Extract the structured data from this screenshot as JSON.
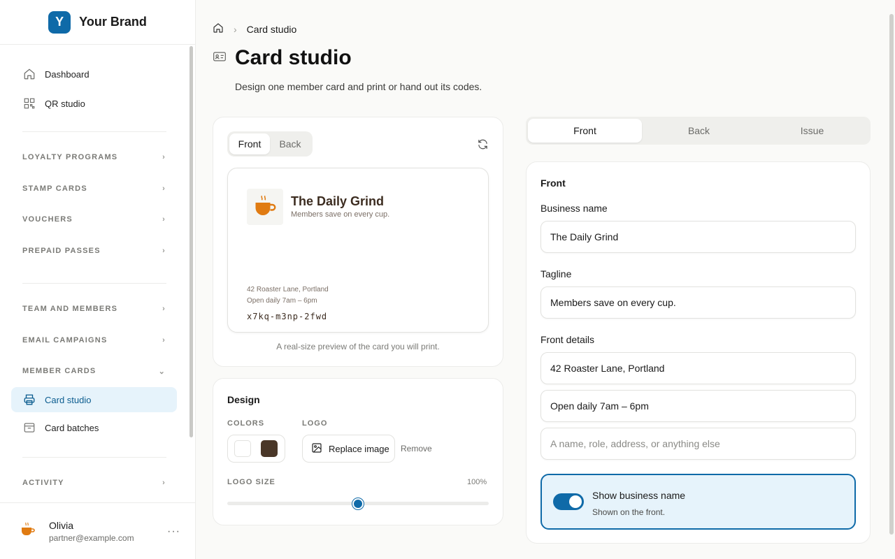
{
  "brand": {
    "letter": "Y",
    "name": "Your Brand"
  },
  "nav": {
    "dashboard": "Dashboard",
    "qr_studio": "QR studio",
    "sections": [
      "LOYALTY PROGRAMS",
      "STAMP CARDS",
      "VOUCHERS",
      "PREPAID PASSES",
      "TEAM AND MEMBERS",
      "EMAIL CAMPAIGNS",
      "MEMBER CARDS",
      "ACTIVITY"
    ],
    "card_studio": "Card studio",
    "card_batches": "Card batches"
  },
  "user": {
    "name": "Olivia",
    "email": "partner@example.com",
    "more": "···"
  },
  "breadcrumb": {
    "current": "Card studio"
  },
  "page": {
    "title": "Card studio",
    "subtitle": "Design one member card and print or hand out its codes."
  },
  "preview_panel": {
    "tabs": [
      "Front",
      "Back"
    ],
    "selected_tab": "Front",
    "card": {
      "business_name": "The Daily Grind",
      "tagline": "Members save on every cup.",
      "address": "42 Roaster Lane, Portland",
      "hours": "Open daily 7am – 6pm",
      "code": "x7kq-m3np-2fwd"
    },
    "note": "A real-size preview of the card you will print."
  },
  "design": {
    "title": "Design",
    "colors_label": "COLORS",
    "colors": [
      "#ffffff",
      "#4a3728"
    ],
    "logo_label": "LOGO",
    "replace_label": "Replace image",
    "remove_label": "Remove",
    "logo_size_label": "LOGO SIZE",
    "logo_size_value": "100%",
    "logo_size_fraction": 0.5
  },
  "editor": {
    "tabs": [
      "Front",
      "Back",
      "Issue"
    ],
    "selected_tab": "Front",
    "section_title": "Front",
    "business_name_label": "Business name",
    "business_name_value": "The Daily Grind",
    "tagline_label": "Tagline",
    "tagline_value": "Members save on every cup.",
    "front_details_label": "Front details",
    "detail_1": "42 Roaster Lane, Portland",
    "detail_2": "Open daily 7am – 6pm",
    "detail_placeholder": "A name, role, address, or anything else",
    "toggle": {
      "title": "Show business name",
      "subtitle": "Shown on the front.",
      "on": true
    }
  },
  "colors": {
    "accent": "#0f6aa8",
    "accent_light": "#e6f3fb",
    "coffee": "#e07b12"
  }
}
